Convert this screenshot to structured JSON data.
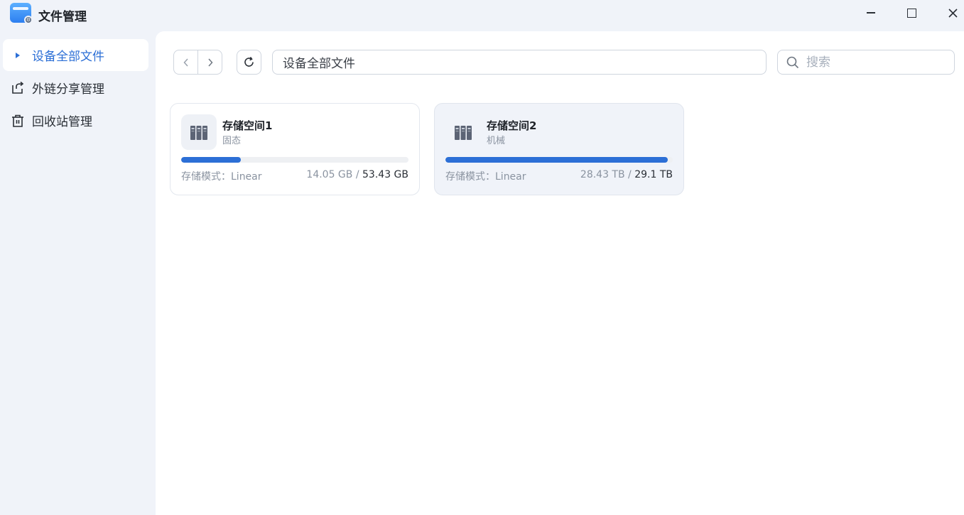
{
  "app": {
    "title": "文件管理"
  },
  "window": {
    "minimize": "",
    "maximize": "",
    "close": "×"
  },
  "sidebar": {
    "items": [
      {
        "label": "设备全部文件",
        "icon": "caret-right-icon",
        "active": true
      },
      {
        "label": "外链分享管理",
        "icon": "share-icon",
        "active": false
      },
      {
        "label": "回收站管理",
        "icon": "trash-icon",
        "active": false
      }
    ]
  },
  "toolbar": {
    "path": "设备全部文件",
    "search_placeholder": "搜索"
  },
  "storage": [
    {
      "name": "存储空间1",
      "type": "固态",
      "mode_label": "存储模式：Linear",
      "used": "14.05 GB",
      "separator": " / ",
      "total": "53.43 GB",
      "used_fraction": 0.263
    },
    {
      "name": "存储空间2",
      "type": "机械",
      "mode_label": "存储模式：Linear",
      "used": "28.43 TB",
      "separator": " / ",
      "total": "29.1 TB",
      "used_fraction": 0.977
    }
  ],
  "colors": {
    "accent": "#2c6fd6",
    "sidebar_bg": "#f0f3f9"
  }
}
